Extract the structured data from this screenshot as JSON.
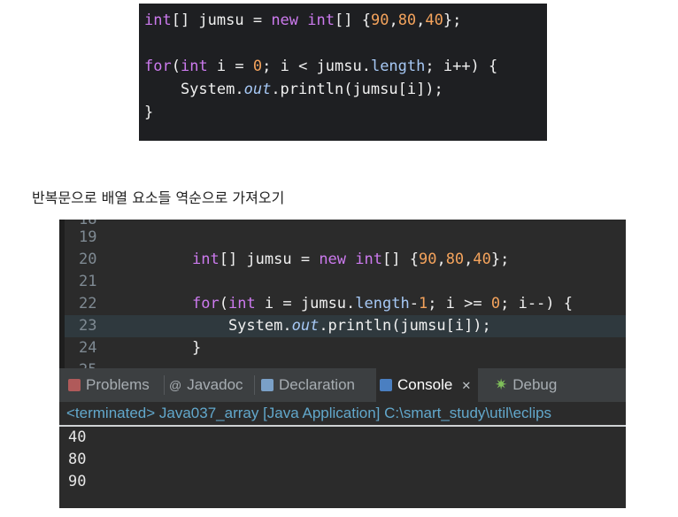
{
  "snippet": {
    "lines": [
      [
        "int",
        "[] jumsu = ",
        "new",
        " ",
        "int",
        "[] {",
        "90",
        ",",
        "80",
        ",",
        "40",
        "};"
      ],
      [],
      [
        "for",
        "(",
        "int",
        " i = ",
        "0",
        "; i < jumsu.",
        "length",
        "; i++) {"
      ],
      [
        "    System.",
        "out",
        ".println(jumsu[i]);"
      ],
      [
        "}"
      ]
    ]
  },
  "caption": "반복문으로 배열 요소들 역순으로 가져오기",
  "editor": {
    "line_numbers": [
      "19",
      "20",
      "21",
      "22",
      "23",
      "24"
    ],
    "line20": [
      "int",
      "[] jumsu = ",
      "new",
      " ",
      "int",
      "[] {",
      "90",
      ",",
      "80",
      ",",
      "40",
      "};"
    ],
    "line22": [
      "for",
      "(",
      "int",
      " i = jumsu.",
      "length",
      "-",
      "1",
      "; i >= ",
      "0",
      "; i--) {"
    ],
    "line23": [
      "    System.",
      "out",
      ".println(jumsu[i]);"
    ],
    "line24": "}"
  },
  "tabs": {
    "problems": "Problems",
    "javadoc": "Javadoc",
    "declaration": "Declaration",
    "console": "Console",
    "console_close": "✕",
    "debug": "Debug"
  },
  "status": "<terminated> Java037_array [Java Application] C:\\smart_study\\util\\eclips",
  "output": [
    "40",
    "80",
    "90"
  ]
}
